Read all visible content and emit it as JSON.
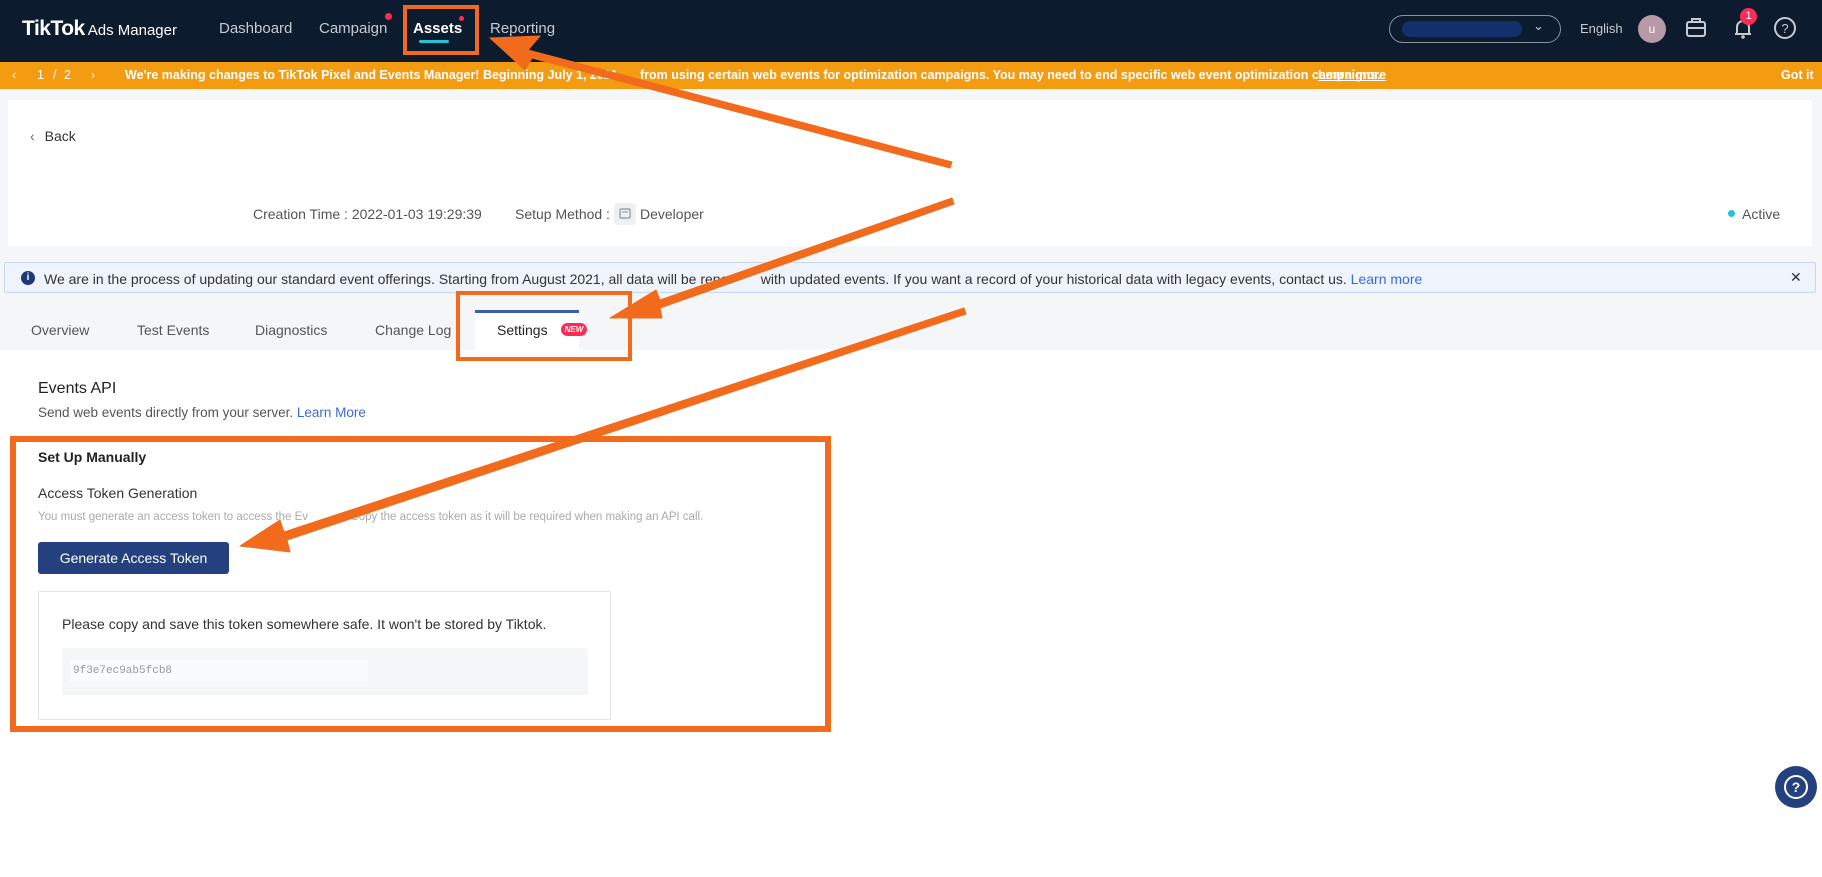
{
  "nav": {
    "logo_brand": "TikTok",
    "logo_product": "Ads Manager",
    "items": [
      "Dashboard",
      "Campaign",
      "Assets",
      "Reporting"
    ],
    "language": "English",
    "avatar_letter": "u",
    "notification_count": "1"
  },
  "announcement": {
    "pager_current": "1",
    "pager_sep": "/",
    "pager_total": "2",
    "message": "We're making changes to TikTok Pixel and Events Manager! Beginning July 1, 2021, [obscured] from using certain web events for optimization campaigns. You may need to end specific web event optimization campaigns.",
    "message_pre": "We're making changes to TikTok Pixel and Events Manager! Beginning July 1, 2021,",
    "message_post": "from using certain web events for optimization campaigns. You may need to end specific web event optimization campaigns.",
    "learn_more": "Learn more",
    "dismiss": "Got it"
  },
  "header": {
    "back": "Back",
    "creation_time": "Creation Time : 2022-01-03 19:29:39",
    "setup_method_label": "Setup Method :",
    "setup_method_value": "Developer",
    "status": "Active"
  },
  "info": {
    "message_pre": "We are in the process of updating our standard event offerings. Starting from August 2021, all data will be repor",
    "message_post": "with updated events. If you want a record of your historical data with legacy events, contact us.",
    "learn_more": "Learn more"
  },
  "tabs": [
    {
      "label": "Overview"
    },
    {
      "label": "Test Events"
    },
    {
      "label": "Diagnostics"
    },
    {
      "label": "Change Log"
    },
    {
      "label": "Settings",
      "badge": "NEW"
    }
  ],
  "events_api": {
    "title": "Events API",
    "subtitle": "Send web events directly from your server.",
    "learn_more": "Learn More",
    "manual_title": "Set Up Manually",
    "token_title": "Access Token Generation",
    "token_desc_pre": "You must generate an access token to access the Ev",
    "token_desc_post": "Copy the access token as it will be required when making an API call.",
    "generate_button": "Generate Access Token",
    "token_notice": "Please copy and save this token somewhere safe. It won't be stored by Tiktok.",
    "token_value": "9f3e7ec9ab5fcb8"
  },
  "colors": {
    "nav_bg": "#0d1b2e",
    "announce_bg": "#f39c12",
    "primary": "#24407f",
    "link": "#3b6bd8",
    "annotation": "#f26a1b",
    "badge": "#fe2c55"
  }
}
